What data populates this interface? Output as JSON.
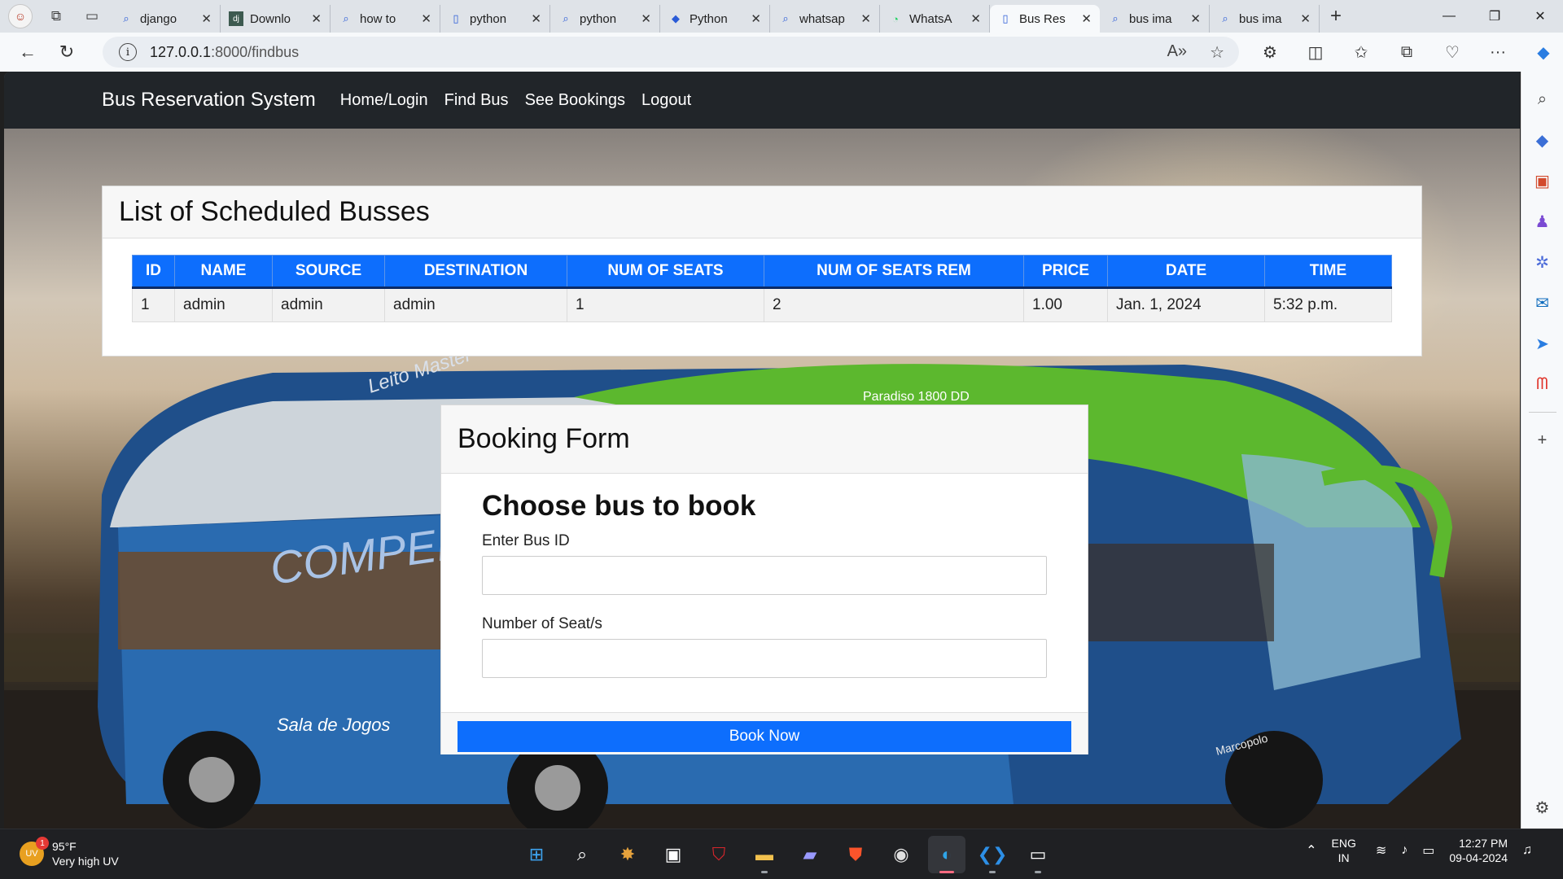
{
  "browser": {
    "tabs": [
      {
        "title": "django",
        "icon": "search-icon"
      },
      {
        "title": "Downlo",
        "icon": "dj-icon"
      },
      {
        "title": "how to",
        "icon": "search-icon"
      },
      {
        "title": "python",
        "icon": "page-icon"
      },
      {
        "title": "python",
        "icon": "search-icon"
      },
      {
        "title": "Python",
        "icon": "python-icon"
      },
      {
        "title": "whatsap",
        "icon": "search-icon"
      },
      {
        "title": "WhatsA",
        "icon": "whatsapp-icon"
      },
      {
        "title": "Bus Res",
        "icon": "page-icon",
        "active": true
      },
      {
        "title": "bus ima",
        "icon": "search-icon"
      },
      {
        "title": "bus ima",
        "icon": "search-icon"
      }
    ],
    "url_host": "127.0.0.1",
    "url_path": ":8000/findbus"
  },
  "site": {
    "brand": "Bus Reservation System",
    "nav": [
      "Home/Login",
      "Find Bus",
      "See Bookings",
      "Logout"
    ]
  },
  "bus_list": {
    "title": "List of Scheduled Busses",
    "headers": [
      "ID",
      "NAME",
      "SOURCE",
      "DESTINATION",
      "NUM OF SEATS",
      "NUM OF SEATS REM",
      "PRICE",
      "DATE",
      "TIME"
    ],
    "rows": [
      [
        "1",
        "admin",
        "admin",
        "admin",
        "1",
        "2",
        "1.00",
        "Jan. 1, 2024",
        "5:32 p.m."
      ]
    ]
  },
  "booking_form": {
    "header": "Booking Form",
    "heading": "Choose bus to book",
    "bus_id_label": "Enter Bus ID",
    "bus_id_value": "",
    "seats_label": "Number of Seat/s",
    "seats_value": "",
    "submit_label": "Book Now"
  },
  "background_text": {
    "bus_brand_1": "Leito Master",
    "bus_brand_2": "COMPERTO",
    "bus_brand_3": "Sala de Jogos",
    "bus_model": "Paradiso 1800 DD",
    "bus_maker": "Marcopolo"
  },
  "taskbar": {
    "uv_badge": "1",
    "uv_label": "UV",
    "temperature": "95°F",
    "weather": "Very high UV",
    "lang_1": "ENG",
    "lang_2": "IN",
    "time": "12:27 PM",
    "date": "09-04-2024"
  },
  "colors": {
    "primary": "#0d6efd",
    "navbar": "#212529",
    "accent_green": "#5cb82e"
  }
}
